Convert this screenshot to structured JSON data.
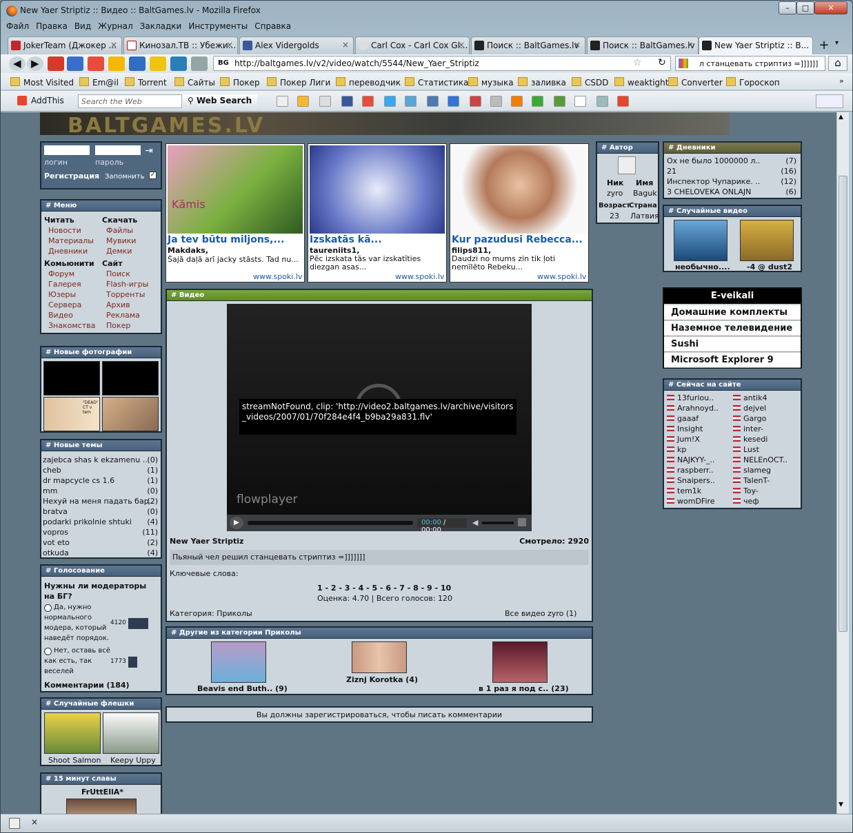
{
  "window": {
    "title": "New Yaer Striptiz :: Видео :: BaltGames.lv - Mozilla Firefox"
  },
  "menu": [
    "Файл",
    "Правка",
    "Вид",
    "Журнал",
    "Закладки",
    "Инструменты",
    "Справка"
  ],
  "tabs": [
    "JokerTeam (Джокер ...",
    "Кинозал.ТВ :: Убежи...",
    "Alex Vidergolds",
    "Carl Cox - Carl Cox Gl...",
    "Поиск :: BaltGames.lv",
    "Поиск :: BaltGames.lv",
    "New Yaer Striptiz :: B..."
  ],
  "nav": {
    "url": "http://baltgames.lv/v2/video/watch/5544/New_Yaer_Striptiz",
    "search": "л станцевать стриптиз =]]]]]]"
  },
  "bookmarks": [
    "Most Visited",
    "Em@il",
    "Torrent",
    "Сайты",
    "Покер",
    "Покер Лиги",
    "переводчик",
    "Статистика",
    "музыка",
    "заливка",
    "CSDD",
    "weaktight",
    "Converter",
    "Гороскоп"
  ],
  "addthis": {
    "label": "AddThis",
    "search_placeholder": "Search the Web",
    "search_button": "Web Search"
  },
  "login": {
    "login_label": "логин",
    "password_label": "пароль",
    "register": "Регистрация",
    "remember": "Запомнить"
  },
  "menu_panel": {
    "title": "# Меню",
    "col1_head": "Читать",
    "col1": [
      "Новости",
      "Материалы",
      "Дневники"
    ],
    "col1b_head": "Комьюнити",
    "col1b": [
      "Форум",
      "Галерея",
      "Юзеры",
      "Сервера",
      "Видео",
      "Знакомства"
    ],
    "col2_head": "Скачать",
    "col2": [
      "Файлы",
      "Мувики",
      "Демки"
    ],
    "col2b_head": "Сайт",
    "col2b": [
      "Поиск",
      "Flash-игры",
      "Торренты",
      "Архив",
      "Реклама",
      "Покер"
    ]
  },
  "photos": {
    "title": "# Новые фотографии",
    "caption": "\"DEAD\" CT v tem"
  },
  "topics": {
    "title": "# Новые темы",
    "items": [
      {
        "t": "zajebca shas k ekzamenu ..",
        "n": "(0)"
      },
      {
        "t": "cheb",
        "n": "(1)"
      },
      {
        "t": "dr mapcycle cs 1.6",
        "n": "(1)"
      },
      {
        "t": "mm",
        "n": "(0)"
      },
      {
        "t": "Нехуй на меня падать бар..",
        "n": "(2)"
      },
      {
        "t": "bratva",
        "n": "(0)"
      },
      {
        "t": "podarki prikolnie shtuki",
        "n": "(4)"
      },
      {
        "t": "vopros",
        "n": "(11)"
      },
      {
        "t": "vot eto",
        "n": "(2)"
      },
      {
        "t": "otkuda",
        "n": "(4)"
      }
    ]
  },
  "poll": {
    "title": "# Голосование",
    "question": "Нужны ли модераторы на БГ?",
    "opt1": [
      "Да, нужно",
      "нормального",
      "модера, который",
      "наведёт порядок."
    ],
    "opt1_votes": "4120",
    "opt2": [
      "Нет, оставь всё",
      "как есть, так",
      "веселей"
    ],
    "opt2_votes": "1773",
    "opt1_share": 0.7,
    "opt2_share": 0.3,
    "comments": "Комментарии (184)"
  },
  "flash": {
    "title": "# Случайные флешки",
    "items": [
      "Shoot Salmon",
      "Keepy Uppy"
    ]
  },
  "fame": {
    "title": "# 15 минут славы",
    "name": "FrUttEllA*"
  },
  "ads": [
    {
      "title": "Ja tev būtu miljons,...",
      "user": "Makdaks,",
      "text": "Šajā daļā arī jacky stāsts. Tad nu...",
      "src": "www.spoki.lv",
      "img": "Kāmis"
    },
    {
      "title": "Izskatās kā...",
      "user": "taureniits1,",
      "text": "Pēc izskata tās var izskatīties diezgan asas...",
      "src": "www.spoki.lv"
    },
    {
      "title": "Kur pazudusi Rebecca...",
      "user": "filips811,",
      "text": "Daudzi no mums zin tik ļoti nemīlēto Rebeku...",
      "src": "www.spoki.lv"
    }
  ],
  "video": {
    "title": "# Видео",
    "error": "streamNotFound, clip: 'http://video2.baltgames.lv/archive/visitors_videos/2007/01/70f284e4f4_b9ba29a831.flv'",
    "brand": "flowplayer",
    "time_cur": "00:00",
    "time_total": "00:00",
    "name": "New Yaer Striptiz",
    "views": "Смотрело: 2920",
    "desc": "Пьяный чел решил станцевать стриптиз =]]]]]]]",
    "keywords": "Ключевые слова:",
    "rating_scale": "1 - 2 - 3 - 4 - 5 - 6 - 7 - 8 - 9 - 10",
    "rating_line": "Оценка: 4.70 | Всего голосов: 120",
    "category": "Категория: Приколы",
    "all_videos": "Все видео zyro (1)"
  },
  "others": {
    "title": "# Другие из категории Приколы",
    "items": [
      "Beavis end Buth.. (9)",
      "Ziznj Korotka (4)",
      "в 1 раз я под с.. (23)"
    ]
  },
  "comment_notice": "Вы должны зарегистрироваться, чтобы писать комментарии",
  "author": {
    "title": "# Автор",
    "nick_label": "Ник",
    "nick": "zyro",
    "name_label": "Имя",
    "name": "Baguk",
    "age_label": "Возраст",
    "age": "23",
    "country_label": "Страна",
    "country": "Латвия"
  },
  "diaries": {
    "title": "# Дневники",
    "items": [
      {
        "t": "Ох не было 1000000 л..",
        "n": "(7)"
      },
      {
        "t": "21",
        "n": "(16)"
      },
      {
        "t": "Инспектор Чупарике. ..",
        "n": "(12)"
      },
      {
        "t": "3 CHELOVEKA ONLAJN",
        "n": "(6)"
      }
    ]
  },
  "random_video": {
    "title": "# Случайные видео",
    "items": [
      "необычно....",
      "-4 @ dust2"
    ]
  },
  "eshops": {
    "title": "E-veikali",
    "items": [
      "Домашние комплекты",
      "Наземное телевидение",
      "Sushi",
      "Microsoft Explorer 9"
    ]
  },
  "online": {
    "title": "# Сейчас на сайте",
    "col1": [
      "13furiou..",
      "Arahnoyd..",
      "gaaaf",
      "Insight",
      "Jum!X",
      "kp",
      "NAJKYY-_..",
      "raspberr..",
      "Snaipers..",
      "tem1k",
      "womDFire"
    ],
    "col2": [
      "antik4",
      "dejvel",
      "Gargo",
      "inter-",
      "kesedi",
      "Lust",
      "NELEnOCT..",
      "slameg",
      "TalenT-",
      "Toy-",
      "чеф"
    ]
  }
}
